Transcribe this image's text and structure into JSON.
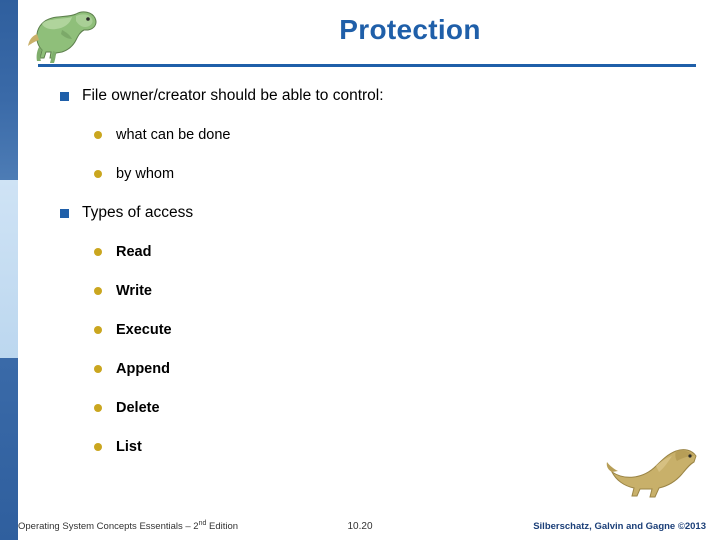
{
  "slide": {
    "title": "Protection",
    "bullets": [
      {
        "level": 1,
        "text": "File owner/creator should be able to control:",
        "bold": false,
        "marker": "square-bullet"
      },
      {
        "level": 2,
        "text": "what can be done",
        "bold": false,
        "marker": "round-bullet"
      },
      {
        "level": 2,
        "text": "by whom",
        "bold": false,
        "marker": "round-bullet"
      },
      {
        "level": 1,
        "text": "Types of access",
        "bold": false,
        "marker": "square-bullet"
      },
      {
        "level": 2,
        "text": "Read",
        "bold": true,
        "marker": "round-bullet"
      },
      {
        "level": 2,
        "text": "Write",
        "bold": true,
        "marker": "round-bullet"
      },
      {
        "level": 2,
        "text": "Execute",
        "bold": true,
        "marker": "round-bullet"
      },
      {
        "level": 2,
        "text": "Append",
        "bold": true,
        "marker": "round-bullet"
      },
      {
        "level": 2,
        "text": "Delete",
        "bold": true,
        "marker": "round-bullet"
      },
      {
        "level": 2,
        "text": "List",
        "bold": true,
        "marker": "round-bullet"
      }
    ]
  },
  "footer": {
    "left_main": "Operating System Concepts Essentials – 2",
    "left_sup": "nd",
    "left_tail": " Edition",
    "center": "10.20",
    "right": "Silberschatz, Galvin and Gagne ©2013"
  },
  "colors": {
    "title_blue": "#1f5fa9",
    "bullet_gold": "#caa61f",
    "bar_blue": "#2f5f9e",
    "bar_light": "#cfe3f5"
  }
}
